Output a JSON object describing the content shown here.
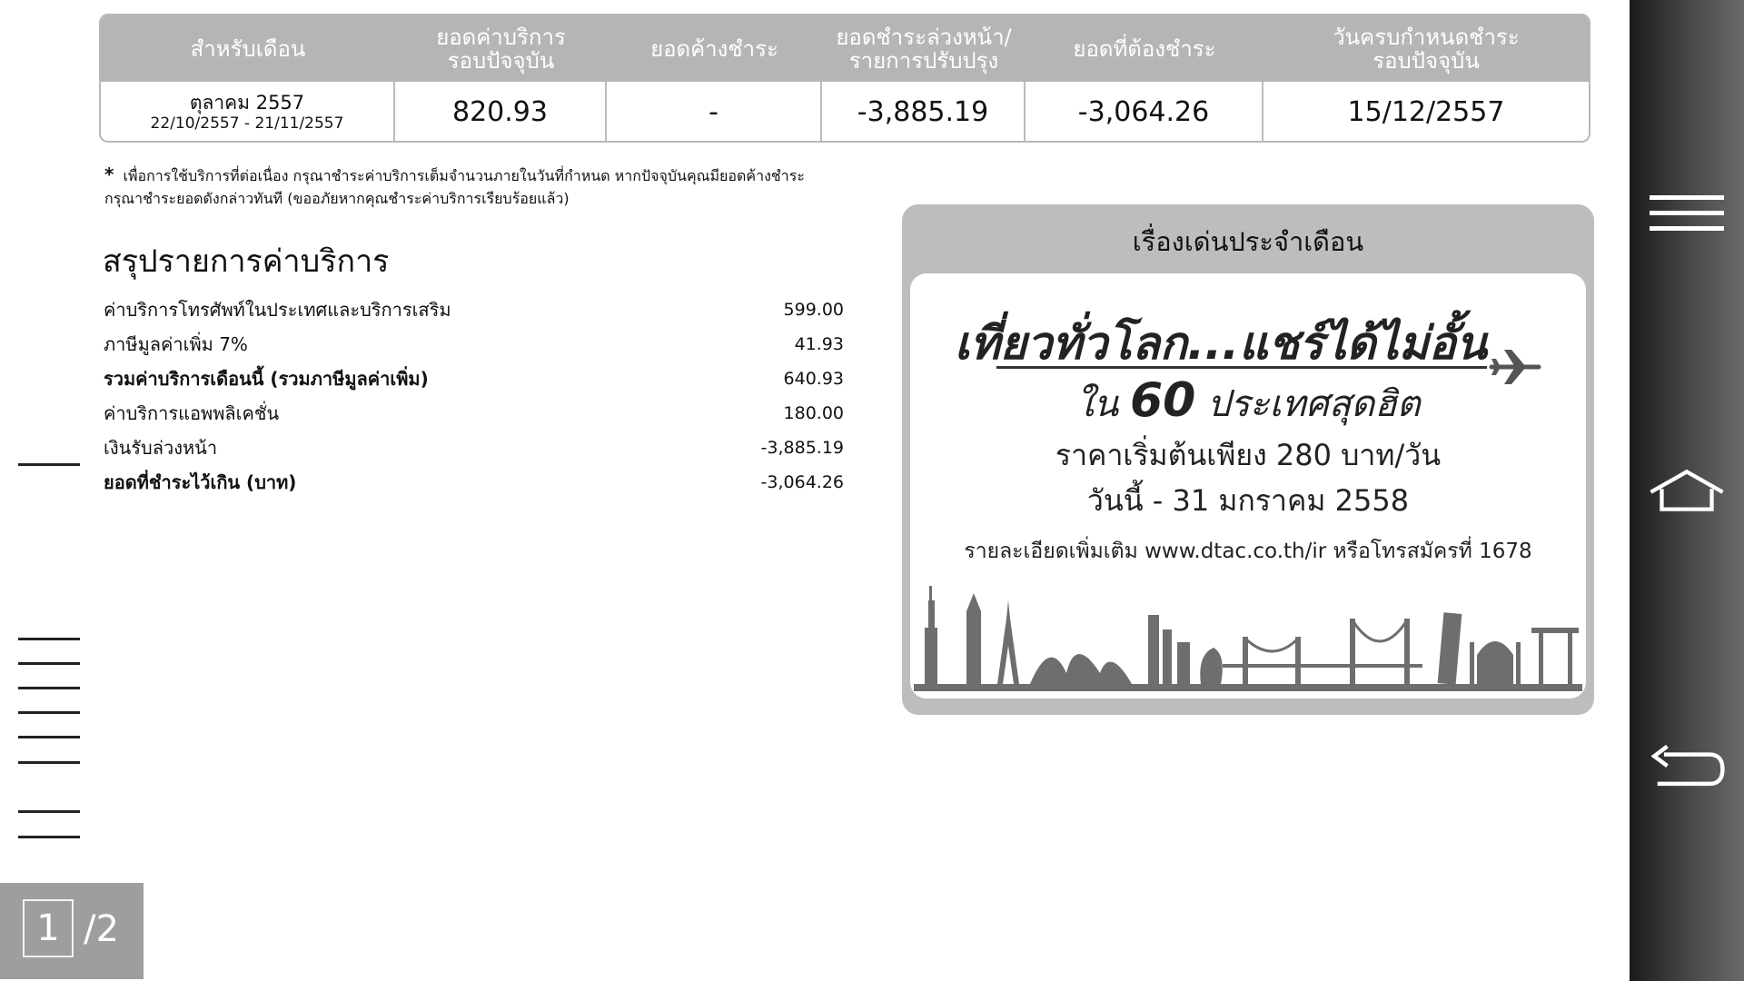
{
  "bill": {
    "headers": [
      "สำหรับเดือน",
      "ยอดค่าบริการ\nรอบปัจจุบัน",
      "ยอดค้างชำระ",
      "ยอดชำระล่วงหน้า/\nรายการปรับปรุง",
      "ยอดที่ต้องชำระ",
      "วันครบกำหนดชำระ\nรอบปัจจุบัน"
    ],
    "period_month": "ตุลาคม 2557",
    "period_range": "22/10/2557 - 21/11/2557",
    "current_charge": "820.93",
    "outstanding": "-",
    "prepaid_adjust": "-3,885.19",
    "amount_due": "-3,064.26",
    "due_date": "15/12/2557"
  },
  "footnote": {
    "star": "*",
    "line1": "เพื่อการใช้บริการที่ต่อเนื่อง กรุณาชำระค่าบริการเต็มจำนวนภายในวันที่กำหนด หากปัจจุบันคุณมียอดค้างชำระ",
    "line2": "กรุณาชำระยอดดังกล่าวทันที (ขออภัยหากคุณชำระค่าบริการเรียบร้อยแล้ว)"
  },
  "summary": {
    "title": "สรุปรายการค่าบริการ",
    "rows": [
      {
        "label": "ค่าบริการโทรศัพท์ในประเทศและบริการเสริม",
        "value": "599.00"
      },
      {
        "label": "ภาษีมูลค่าเพิ่ม 7%",
        "value": "41.93"
      },
      {
        "label": "รวมค่าบริการเดือนนี้ (รวมภาษีมูลค่าเพิ่ม)",
        "value": "640.93"
      },
      {
        "label": "ค่าบริการแอพพลิเคชั่น",
        "value": "180.00"
      },
      {
        "label": "เงินรับล่วงหน้า",
        "value": "-3,885.19"
      },
      {
        "label": "ยอดที่ชำระไว้เกิน (บาท)",
        "value": "-3,064.26"
      }
    ]
  },
  "promo": {
    "title": "เรื่องเด่นประจำเดือน",
    "headline": "เที่ยวทั่วโลก...แชร์ได้ไม่อั้น",
    "sub_prefix": "ใน",
    "sub_number": "60",
    "sub_suffix": "ประเทศสุดฮิต",
    "price": "ราคาเริ่มต้นเพียง 280 บาท/วัน",
    "date": "วันนี้ - 31 มกราคม 2558",
    "detail": "รายละเอียดเพิ่มเติม www.dtac.co.th/ir หรือโทรสมัครที่ 1678"
  },
  "pager": {
    "current": "1",
    "total": "/2"
  },
  "icons": {
    "menu": "menu-icon",
    "home": "home-icon",
    "back": "back-icon",
    "plane": "airplane-icon"
  },
  "colors": {
    "header_gray": "#b5b5b5",
    "navbar_dark": "#1a1a1a"
  }
}
